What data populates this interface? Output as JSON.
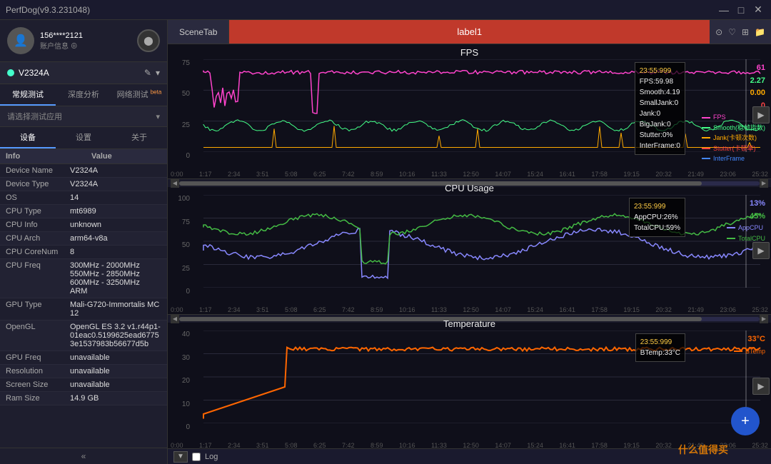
{
  "titleBar": {
    "title": "PerfDog(v9.3.231048)",
    "minBtn": "—",
    "maxBtn": "□",
    "closeBtn": "✕"
  },
  "leftPanel": {
    "user": {
      "id": "156****2121",
      "accountLabel": "账户信息 ⊕",
      "refreshIcon": "↻"
    },
    "device": {
      "name": "V2324A",
      "icon": "✦",
      "editIcon": "✎",
      "dropIcon": "▾"
    },
    "navTabs": [
      {
        "label": "常规测试",
        "active": true
      },
      {
        "label": "深度分析",
        "active": false
      },
      {
        "label": "网络测试",
        "active": false,
        "badge": "beta"
      }
    ],
    "appSelector": {
      "placeholder": "请选择测试应用",
      "dropIcon": "▾"
    },
    "tabs": {
      "labels": [
        "设备",
        "设置",
        "关于"
      ],
      "active": 0
    },
    "infoTable": {
      "headers": [
        "Info",
        "Value"
      ],
      "rows": [
        {
          "key": "Device Name",
          "value": "V2324A"
        },
        {
          "key": "Device Type",
          "value": "V2324A"
        },
        {
          "key": "OS",
          "value": "14"
        },
        {
          "key": "CPU Type",
          "value": "mt6989"
        },
        {
          "key": "CPU Info",
          "value": "unknown"
        },
        {
          "key": "CPU Arch",
          "value": "arm64-v8a"
        },
        {
          "key": "CPU CoreNum",
          "value": "8"
        },
        {
          "key": "CPU Freq",
          "value": "300MHz - 2000MHz\n550MHz - 2850MHz\n600MHz - 3250MHz\nARM"
        },
        {
          "key": "GPU Type",
          "value": "Mali-G720-Immortalis MC12"
        },
        {
          "key": "OpenGL",
          "value": "OpenGL ES 3.2 v1.r44p1-01eac0.5199625ead67753e1537983b56677d5b"
        },
        {
          "key": "GPU Freq",
          "value": "unavailable"
        },
        {
          "key": "Resolution",
          "value": "unavailable"
        },
        {
          "key": "Screen Size",
          "value": "unavailable"
        },
        {
          "key": "Ram Size",
          "value": "14.9 GB"
        }
      ]
    },
    "collapseIcon": "«"
  },
  "rightPanel": {
    "sceneTab": "SceneTab",
    "labelBar": "label1",
    "topIcons": [
      "⊙",
      "♡",
      "⊞",
      "▶"
    ],
    "charts": [
      {
        "id": "fps",
        "title": "FPS",
        "yMax": 75,
        "yTicks": [
          "75",
          "50",
          "25",
          "0"
        ],
        "xTicks": [
          "0:00",
          "1:17",
          "2:34",
          "3:51",
          "5:08",
          "6:25",
          "7:42",
          "8:59",
          "10:16",
          "11:33",
          "12:50",
          "14:07",
          "15:24",
          "16:41",
          "17:58",
          "19:15",
          "20:32",
          "21:49",
          "23:06",
          "25:32"
        ],
        "annotation": {
          "time": "23:55:999",
          "lines": [
            "FPS:59.98",
            "Smooth:4.19",
            "SmallJank:0",
            "Jank:0",
            "BigJank:0",
            "Stutter:0%",
            "InterFrame:0"
          ]
        },
        "valuesBadge": [
          "61",
          "2.27",
          "0.00",
          "0"
        ],
        "legend": [
          {
            "color": "#ff44cc",
            "label": "FPS"
          },
          {
            "color": "#44ff88",
            "label": "Smooth(稳帧指数)"
          },
          {
            "color": "#ffaa00",
            "label": "Jank(卡顿次数)"
          },
          {
            "color": "#ff4444",
            "label": "Stutter(卡顿率)"
          },
          {
            "color": "#4488ff",
            "label": "InterFrame"
          }
        ]
      },
      {
        "id": "cpu",
        "title": "CPU Usage",
        "yMax": 100,
        "yTicks": [
          "100",
          "75",
          "50",
          "25",
          "0"
        ],
        "xTicks": [
          "0:00",
          "1:17",
          "2:34",
          "3:51",
          "5:08",
          "6:25",
          "7:42",
          "8:59",
          "10:16",
          "11:33",
          "12:50",
          "14:07",
          "15:24",
          "16:41",
          "17:58",
          "19:15",
          "20:32",
          "21:49",
          "23:06",
          "25:32"
        ],
        "annotation": {
          "time": "23:55:999",
          "lines": [
            "AppCPU:26%",
            "TotalCPU:59%"
          ]
        },
        "valuesBadge": [
          "13%",
          "45%"
        ],
        "legend": [
          {
            "color": "#8888ff",
            "label": "AppCPU"
          },
          {
            "color": "#44bb44",
            "label": "TotalCPU"
          }
        ]
      },
      {
        "id": "temp",
        "title": "Temperature",
        "yMax": 40,
        "yTicks": [
          "40",
          "30",
          "20",
          "10",
          "0"
        ],
        "xTicks": [
          "0:00",
          "1:17",
          "2:34",
          "3:51",
          "5:08",
          "6:25",
          "7:42",
          "8:59",
          "10:16",
          "11:33",
          "12:50",
          "14:07",
          "15:24",
          "16:41",
          "17:58",
          "19:15",
          "20:32",
          "21:49",
          "23:06",
          "25:32"
        ],
        "annotation": {
          "time": "23:55:999",
          "lines": [
            "BTemp:33°C"
          ]
        },
        "valuesBadge": [
          "33°C"
        ],
        "legend": [
          {
            "color": "#ff6600",
            "label": "BTemp"
          }
        ]
      }
    ],
    "bottomBar": {
      "downBtn": "▼",
      "checkboxLabel": "Log"
    },
    "fabBtn": "+",
    "watermark": "什么值得买"
  }
}
